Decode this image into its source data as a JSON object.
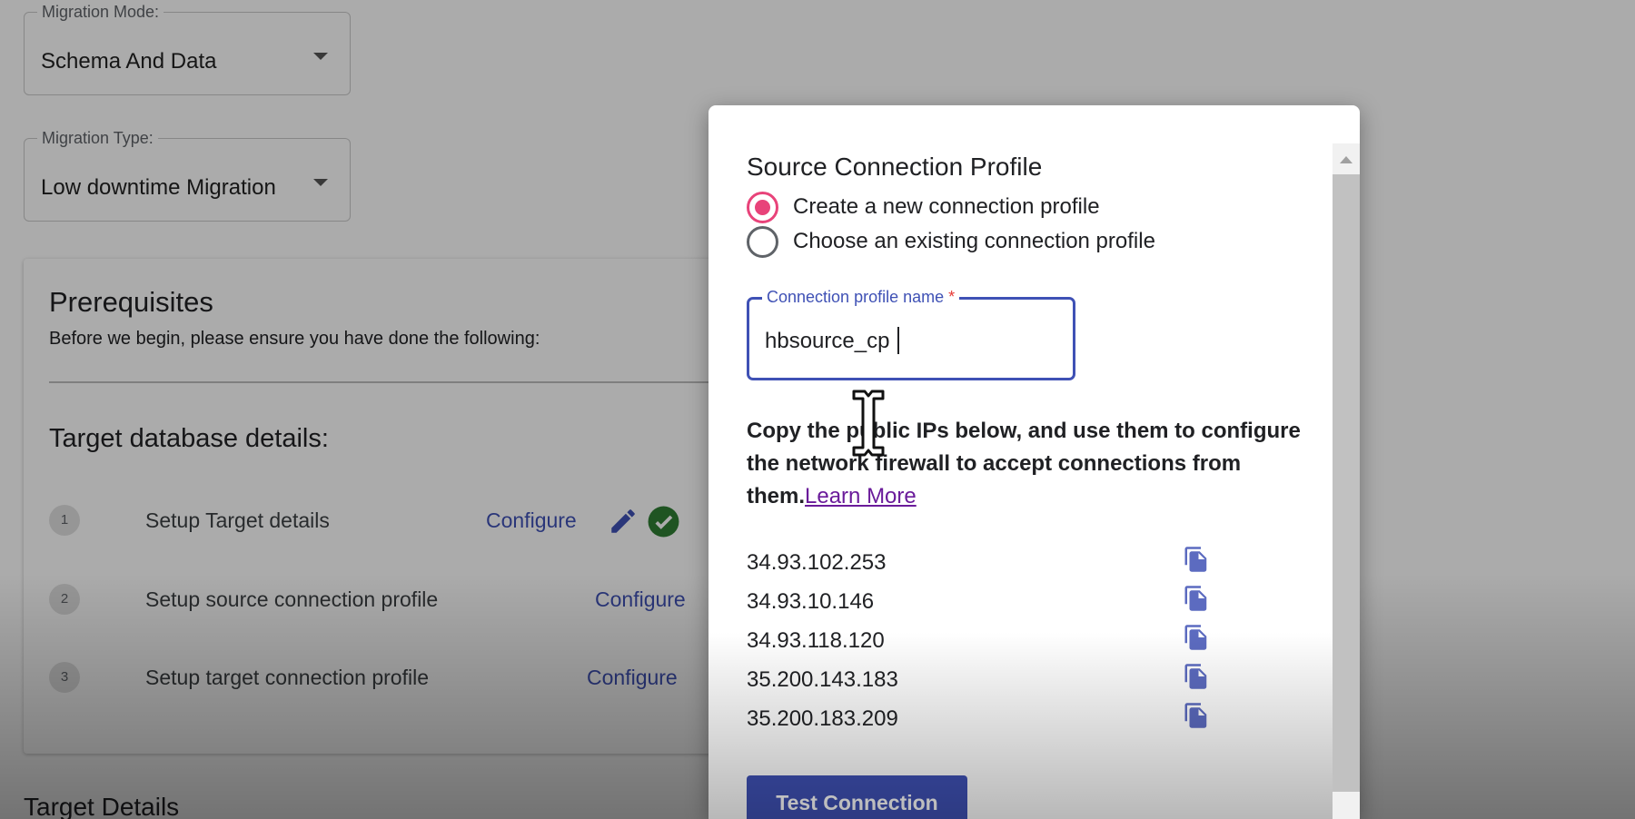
{
  "form": {
    "migration_mode": {
      "label": "Migration Mode:",
      "value": "Schema And Data"
    },
    "migration_type": {
      "label": "Migration Type:",
      "value": "Low downtime Migration"
    }
  },
  "prerequisites": {
    "title": "Prerequisites",
    "subtitle": "Before we begin, please ensure you have done the following:",
    "section_title": "Target database details:",
    "steps": [
      {
        "number": "1",
        "label": "Setup Target details",
        "link": "Configure"
      },
      {
        "number": "2",
        "label": "Setup source connection profile",
        "link": "Configure"
      },
      {
        "number": "3",
        "label": "Setup target connection profile",
        "link": "Configure"
      }
    ]
  },
  "target_details_title": "Target Details",
  "dialog": {
    "title": "Source Connection Profile",
    "radio_options": [
      {
        "label": "Create a new connection profile",
        "checked": true
      },
      {
        "label": "Choose an existing connection profile",
        "checked": false
      }
    ],
    "profile_name": {
      "label": "Connection profile name",
      "required_mark": "*",
      "value": "hbsource_cp"
    },
    "info_text": "Copy the public IPs below, and use them to configure the network firewall to accept connections from them.",
    "learn_more": "Learn More",
    "ips": [
      "34.93.102.253",
      "34.93.10.146",
      "34.93.118.120",
      "35.200.143.183",
      "35.200.183.209"
    ],
    "test_button": "Test Connection"
  },
  "colors": {
    "primary": "#3f51b5",
    "radio_accent": "#e8437a",
    "success": "#2e7d32",
    "link_visited": "#6a1b9a"
  },
  "icons": [
    "chevron-down-icon",
    "pencil-icon",
    "check-circle-icon",
    "copy-icon",
    "text-cursor-icon",
    "scroll-up-icon"
  ]
}
